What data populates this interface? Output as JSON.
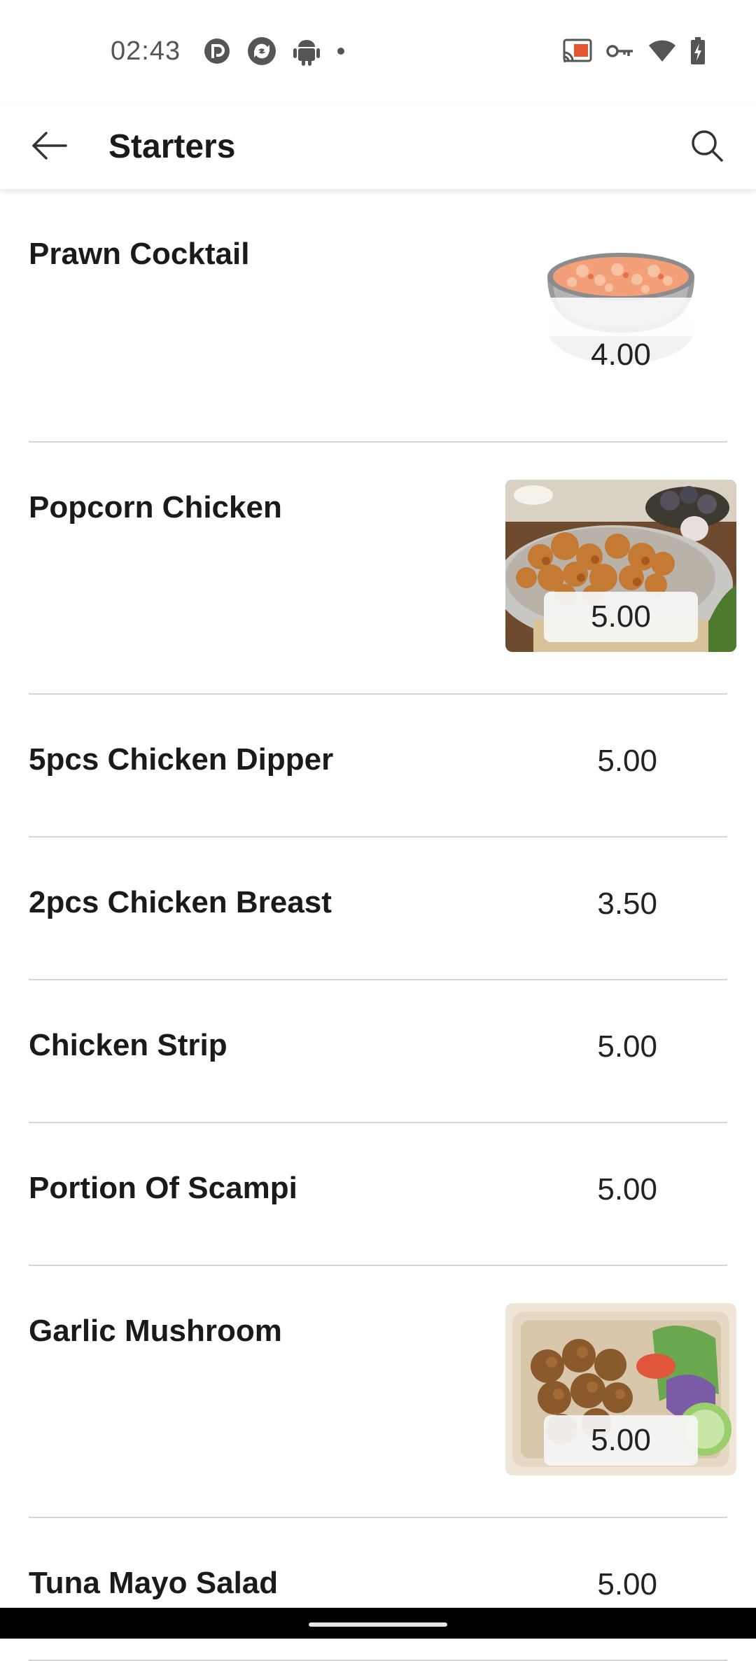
{
  "status_bar": {
    "time": "02:43",
    "left_icons": [
      "pocket-casts-icon",
      "sync-app-icon",
      "android-icon",
      "notification-dot-icon"
    ],
    "right_icons": [
      "cast-icon",
      "vpn-key-icon",
      "wifi-icon",
      "battery-charging-icon"
    ]
  },
  "header": {
    "title": "Starters",
    "back_icon": "arrow-left-icon",
    "search_icon": "search-icon"
  },
  "menu": {
    "items": [
      {
        "name": "Prawn Cocktail",
        "price": "4.00",
        "image": "prawn-cocktail-bowl"
      },
      {
        "name": "Popcorn Chicken",
        "price": "5.00",
        "image": "popcorn-chicken-plate"
      },
      {
        "name": "5pcs Chicken Dipper",
        "price": "5.00"
      },
      {
        "name": "2pcs Chicken Breast",
        "price": "3.50"
      },
      {
        "name": "Chicken Strip",
        "price": "5.00"
      },
      {
        "name": "Portion Of Scampi",
        "price": "5.00"
      },
      {
        "name": "Garlic Mushroom",
        "price": "5.00",
        "image": "garlic-mushroom-box"
      },
      {
        "name": "Tuna Mayo Salad",
        "price": "5.00"
      }
    ]
  },
  "colors": {
    "divider": "#d6d6d6",
    "title_text": "#1a1a1a",
    "nav_bar": "#000000"
  }
}
